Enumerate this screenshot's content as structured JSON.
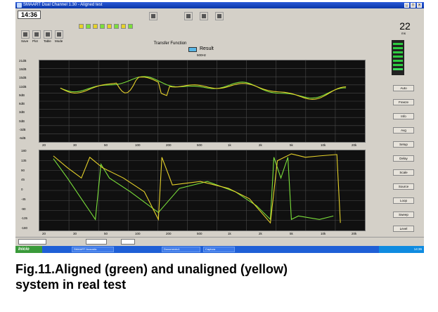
{
  "window": {
    "title": "SMAART Dual Channel 1.30 - Aligned test"
  },
  "toolbar": {
    "time": "14:36",
    "buttons": [
      "Save",
      "Plot",
      "Table",
      "Mode"
    ]
  },
  "plot_header": {
    "title": "Transfer Function",
    "legend_label": "Result",
    "subtitle": "500Hz"
  },
  "right_panel": {
    "value": "22",
    "unit": "ms",
    "labels": [
      "Auto",
      "Freeze",
      "Info",
      "Avg",
      "Setup",
      "Delay",
      "Scale",
      "Source",
      "Loop",
      "Sweep",
      "Level"
    ]
  },
  "magnitude_plot": {
    "y_ticks": [
      "21dB",
      "18dB",
      "15dB",
      "12dB",
      "9dB",
      "6dB",
      "3dB",
      "0dB",
      "-3dB",
      "-6dB"
    ],
    "x_ticks": [
      "20",
      "30",
      "50",
      "100",
      "200",
      "500",
      "1k",
      "2k",
      "5k",
      "10k",
      "20k"
    ]
  },
  "phase_plot": {
    "y_ticks": [
      "180",
      "135",
      "90",
      "45",
      "0",
      "-45",
      "-90",
      "-135",
      "-180"
    ],
    "x_ticks": [
      "20",
      "30",
      "50",
      "100",
      "200",
      "500",
      "1k",
      "2k",
      "5k",
      "10k",
      "20k"
    ]
  },
  "taskbar": {
    "start": "Inicio",
    "tasks": [
      "SMAART Acoustic",
      "Documento1",
      "Captura"
    ],
    "clock": "14:36"
  },
  "caption": {
    "line1": "Fig.11.Aligned (green) and unaligned (yellow)",
    "line2": "system in real test"
  },
  "chart_data": {
    "type": "line",
    "series": [
      {
        "name": "green",
        "color": "#7be03a"
      },
      {
        "name": "yellow",
        "color": "#e6d22a"
      }
    ]
  }
}
